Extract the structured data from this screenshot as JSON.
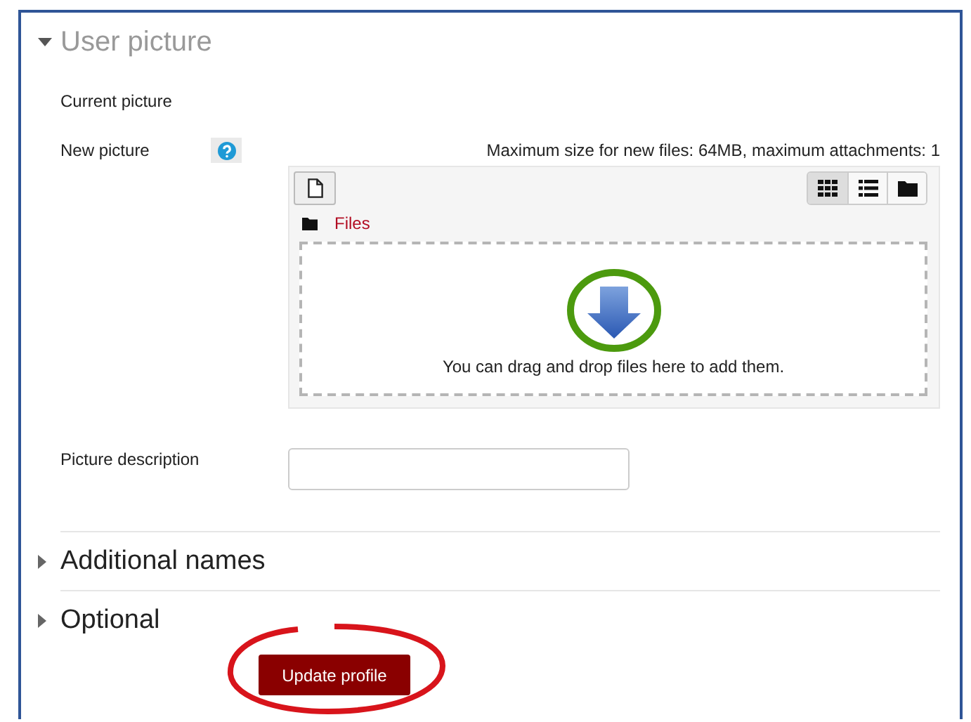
{
  "sections": [
    {
      "title": "User picture",
      "expanded": true
    },
    {
      "title": "Additional names",
      "expanded": false
    },
    {
      "title": "Optional",
      "expanded": false
    }
  ],
  "fields": [
    {
      "kind": "static",
      "label": "Current picture"
    },
    {
      "kind": "filepicker",
      "label": "New picture",
      "help": true,
      "limits": "Maximum size for new files: 64MB, maximum attachments: 1",
      "path": "Files",
      "views": [
        {
          "kind": "icons",
          "selected": true
        },
        {
          "kind": "list",
          "selected": false
        },
        {
          "kind": "tree",
          "selected": false
        }
      ],
      "drop_hint": "You can drag and drop files here to add them."
    },
    {
      "kind": "text",
      "label": "Picture description"
    }
  ],
  "submit": {
    "label": "Update profile",
    "highlighted": true
  }
}
